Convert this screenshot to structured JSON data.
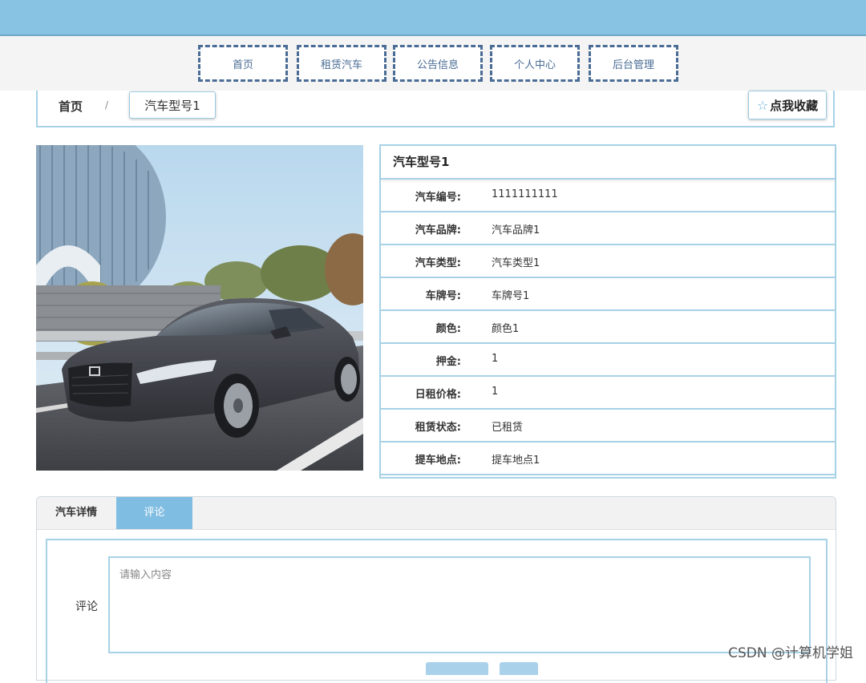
{
  "nav": {
    "items": [
      {
        "label": "首页"
      },
      {
        "label": "租赁汽车"
      },
      {
        "label": "公告信息"
      },
      {
        "label": "个人中心"
      },
      {
        "label": "后台管理"
      }
    ]
  },
  "breadcrumb": {
    "home": "首页",
    "separator": "/",
    "current": "汽车型号1"
  },
  "favorite_button": {
    "icon": "star-outline-icon",
    "label": "点我收藏"
  },
  "info": {
    "title": "汽车型号1",
    "rows": [
      {
        "label": "汽车编号:",
        "value": "1111111111"
      },
      {
        "label": "汽车品牌:",
        "value": "汽车品牌1"
      },
      {
        "label": "汽车类型:",
        "value": "汽车类型1"
      },
      {
        "label": "车牌号:",
        "value": "车牌号1"
      },
      {
        "label": "颜色:",
        "value": "颜色1"
      },
      {
        "label": "押金:",
        "value": "1"
      },
      {
        "label": "日租价格:",
        "value": "1"
      },
      {
        "label": "租赁状态:",
        "value": "已租赁"
      },
      {
        "label": "提车地点:",
        "value": "提车地点1"
      }
    ]
  },
  "tabs": {
    "items": [
      {
        "label": "汽车详情",
        "active": false
      },
      {
        "label": "评论",
        "active": true
      }
    ]
  },
  "comment": {
    "label": "评论",
    "placeholder": "请输入内容"
  },
  "watermark": "CSDN @计算机学姐",
  "colors": {
    "top_band": "#88c3e4",
    "accent": "#80bde2",
    "border": "#a7d2e6",
    "nav_text": "#4a6c95"
  }
}
